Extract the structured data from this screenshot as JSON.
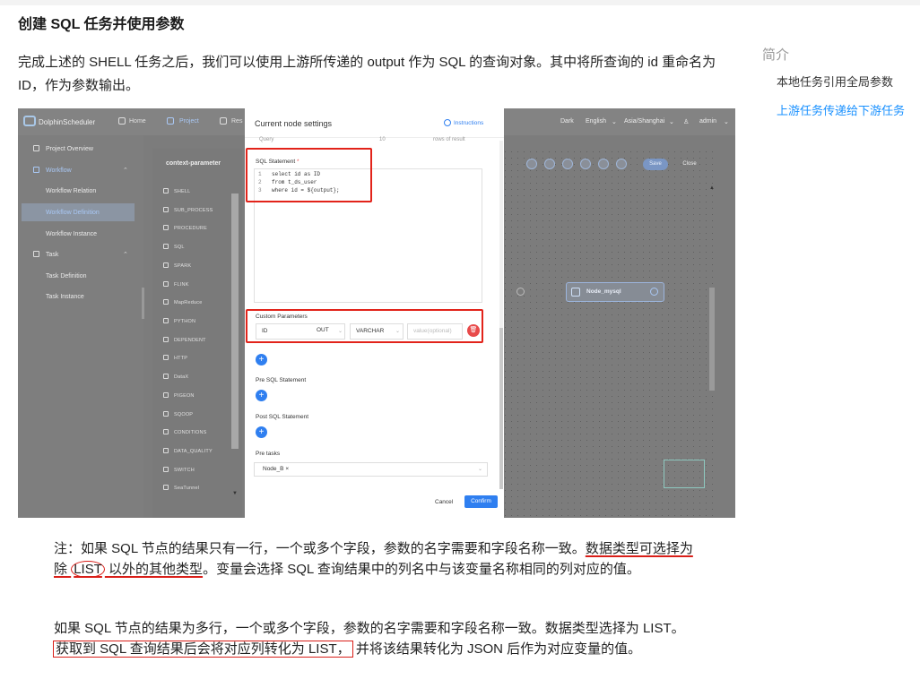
{
  "doc": {
    "heading": "创建 SQL 任务并使用参数",
    "paragraph": "完成上述的 SHELL 任务之后，我们可以使用上游所传递的 output 作为 SQL 的查询对象。其中将所查询的 id 重命名为 ID，作为参数输出。"
  },
  "toc": {
    "title": "简介",
    "items": [
      "本地任务引用全局参数",
      "上游任务传递给下游任务"
    ]
  },
  "app": {
    "brand": "DolphinScheduler",
    "nav": [
      "Home",
      "Project",
      "Res"
    ],
    "theme": "Dark",
    "language": "English",
    "timezone": "Asia/Shanghai",
    "user": "admin"
  },
  "sidebar": {
    "project_overview": "Project Overview",
    "workflow": "Workflow",
    "workflow_relation": "Workflow Relation",
    "workflow_definition": "Workflow Definition",
    "workflow_instance": "Workflow Instance",
    "task": "Task",
    "task_definition": "Task Definition",
    "task_instance": "Task Instance"
  },
  "palette": {
    "title": "context-parameter",
    "items": [
      "SHELL",
      "SUB_PROCESS",
      "PROCEDURE",
      "SQL",
      "SPARK",
      "FLINK",
      "MapReduce",
      "PYTHON",
      "DEPENDENT",
      "HTTP",
      "DataX",
      "PIGEON",
      "SQOOP",
      "CONDITIONS",
      "DATA_QUALITY",
      "SWITCH",
      "SeaTunnel"
    ]
  },
  "canvas": {
    "save": "Save",
    "close": "Close",
    "node_label": "Node_mysql"
  },
  "modal": {
    "title": "Current node settings",
    "instructions": "Instructions",
    "cut_row_left": "Query",
    "cut_row_mid": "10",
    "cut_row_right": "rows of result",
    "sql_label": "SQL Statement",
    "required_mark": "*",
    "sql_lines": [
      "select id as ID",
      "from t_ds_user",
      "where id = ${output};"
    ],
    "custom_params_label": "Custom Parameters",
    "param": {
      "name": "ID",
      "direction": "OUT",
      "type": "VARCHAR",
      "value_placeholder": "value(optional)"
    },
    "pre_sql_label": "Pre SQL Statement",
    "post_sql_label": "Post SQL Statement",
    "pre_tasks_label": "Pre tasks",
    "pre_task_tag": "Node_B",
    "cancel": "Cancel",
    "confirm": "Confirm"
  },
  "notes": {
    "n1_a": "注：如果 SQL 节点的结果只有一行，一个或多个字段，参数的名字需要和字段名称一致。",
    "n1_b": "数据类型可选择为除",
    "n1_c": "LIST",
    "n1_d": "以外的其他类型",
    "n1_e": "。变量会选择 SQL 查询结果中的列名中与该变量名称相同的列对应的值。",
    "n2_a": "如果 SQL 节点的结果为多行，一个或多个字段，参数的名字需要和字段名称一致。数据类型选择为 LIST。",
    "n2_b": "获取到 SQL 查询结果后会将对应列转化为 LIST，",
    "n2_c": "并将该结果转化为 JSON 后作为对应变量的值。"
  },
  "colors": {
    "accent": "#1890ff",
    "annotation_red": "#e2231a",
    "primary_button": "#2f7ff0"
  }
}
